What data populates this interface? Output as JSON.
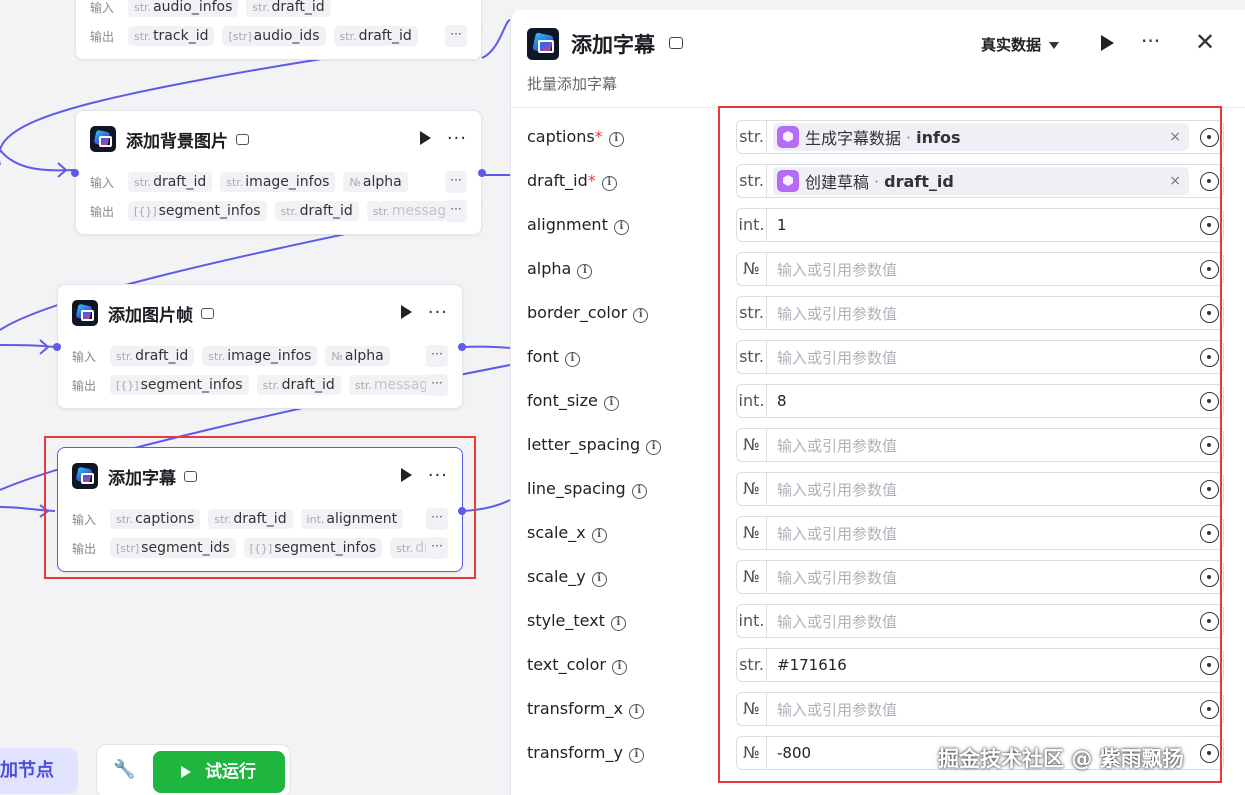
{
  "canvas": {
    "input_label": "输入",
    "output_label": "输出",
    "more": "···",
    "nodes": [
      {
        "title": "",
        "inputs": [
          {
            "type": "str.",
            "name": "audio_infos"
          },
          {
            "type": "str.",
            "name": "draft_id"
          }
        ],
        "outputs": [
          {
            "type": "str.",
            "name": "track_id"
          },
          {
            "type": "[str]",
            "name": "audio_ids"
          },
          {
            "type": "str.",
            "name": "draft_id"
          }
        ]
      },
      {
        "title": "添加背景图片",
        "inputs": [
          {
            "type": "str.",
            "name": "draft_id"
          },
          {
            "type": "str.",
            "name": "image_infos"
          },
          {
            "type": "№",
            "name": "alpha"
          }
        ],
        "outputs": [
          {
            "type": "[{}]",
            "name": "segment_infos"
          },
          {
            "type": "str.",
            "name": "draft_id"
          },
          {
            "type": "str.",
            "name": "messag"
          }
        ]
      },
      {
        "title": "添加图片帧",
        "inputs": [
          {
            "type": "str.",
            "name": "draft_id"
          },
          {
            "type": "str.",
            "name": "image_infos"
          },
          {
            "type": "№",
            "name": "alpha"
          }
        ],
        "outputs": [
          {
            "type": "[{}]",
            "name": "segment_infos"
          },
          {
            "type": "str.",
            "name": "draft_id"
          },
          {
            "type": "str.",
            "name": "messag"
          }
        ]
      },
      {
        "title": "添加字幕",
        "inputs": [
          {
            "type": "str.",
            "name": "captions"
          },
          {
            "type": "str.",
            "name": "draft_id"
          },
          {
            "type": "int.",
            "name": "alignment"
          }
        ],
        "outputs": [
          {
            "type": "[str]",
            "name": "segment_ids"
          },
          {
            "type": "[{}]",
            "name": "segment_infos"
          },
          {
            "type": "str.",
            "name": "dra"
          }
        ]
      }
    ],
    "toolbar": {
      "add_node": "加节点",
      "test_run": "试运行"
    }
  },
  "panel": {
    "title": "添加字幕",
    "description": "批量添加字幕",
    "mode": "真实数据",
    "fields": [
      {
        "name": "captions",
        "required": true,
        "type": "str.",
        "ref_node": "生成字幕数据",
        "ref_field": "infos"
      },
      {
        "name": "draft_id",
        "required": true,
        "type": "str.",
        "ref_node": "创建草稿",
        "ref_field": "draft_id"
      },
      {
        "name": "alignment",
        "type": "int.",
        "value": "1"
      },
      {
        "name": "alpha",
        "type": "№",
        "placeholder": "输入或引用参数值"
      },
      {
        "name": "border_color",
        "type": "str.",
        "placeholder": "输入或引用参数值"
      },
      {
        "name": "font",
        "type": "str.",
        "placeholder": "输入或引用参数值"
      },
      {
        "name": "font_size",
        "type": "int.",
        "value": "8"
      },
      {
        "name": "letter_spacing",
        "type": "№",
        "placeholder": "输入或引用参数值"
      },
      {
        "name": "line_spacing",
        "type": "№",
        "placeholder": "输入或引用参数值"
      },
      {
        "name": "scale_x",
        "type": "№",
        "placeholder": "输入或引用参数值"
      },
      {
        "name": "scale_y",
        "type": "№",
        "placeholder": "输入或引用参数值"
      },
      {
        "name": "style_text",
        "type": "int.",
        "placeholder": "输入或引用参数值"
      },
      {
        "name": "text_color",
        "type": "str.",
        "value": "#171616"
      },
      {
        "name": "transform_x",
        "type": "№",
        "placeholder": "输入或引用参数值"
      },
      {
        "name": "transform_y",
        "type": "№",
        "value": "-800"
      }
    ]
  },
  "watermark": "掘金技术社区 @ 紫雨飘扬",
  "colors": {
    "accent": "#5e5ce6",
    "run_green": "#1fb640",
    "highlight_red": "#e5393b"
  }
}
